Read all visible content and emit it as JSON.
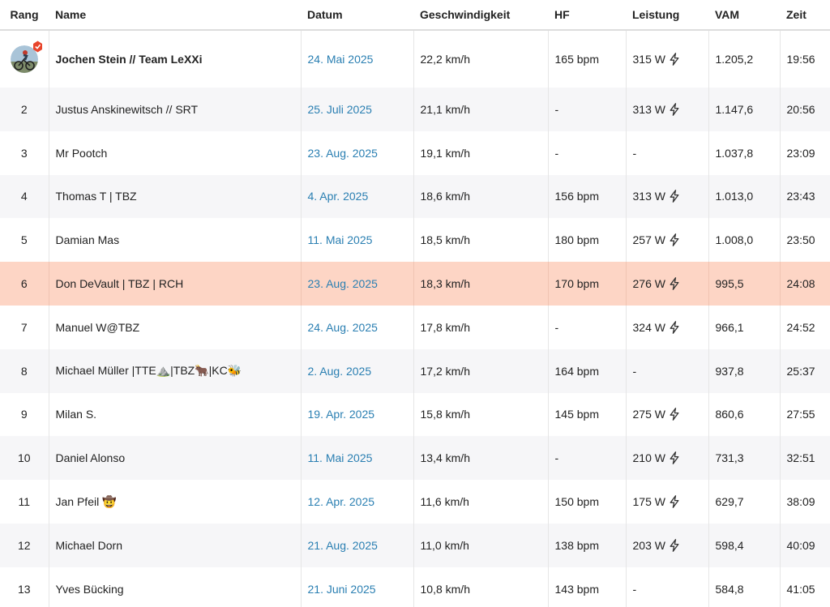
{
  "table": {
    "headers": [
      "Rang",
      "Name",
      "Datum",
      "Geschwindigkeit",
      "HF",
      "Leistung",
      "VAM",
      "Zeit"
    ],
    "rows": [
      {
        "rank": "",
        "name": "Jochen Stein // Team LeXXi",
        "date": "24. Mai 2025",
        "speed": "22,2 km/h",
        "hr": "165 bpm",
        "power": "315 W",
        "vam": "1.205,2",
        "time": "19:56"
      },
      {
        "rank": "2",
        "name": "Justus Anskinewitsch // SRT",
        "date": "25. Juli 2025",
        "speed": "21,1 km/h",
        "hr": "-",
        "power": "313 W",
        "vam": "1.147,6",
        "time": "20:56"
      },
      {
        "rank": "3",
        "name": "Mr Pootch",
        "date": "23. Aug. 2025",
        "speed": "19,1 km/h",
        "hr": "-",
        "power": "-",
        "vam": "1.037,8",
        "time": "23:09"
      },
      {
        "rank": "4",
        "name": "Thomas T | TBZ",
        "date": "4. Apr. 2025",
        "speed": "18,6 km/h",
        "hr": "156 bpm",
        "power": "313 W",
        "vam": "1.013,0",
        "time": "23:43"
      },
      {
        "rank": "5",
        "name": "Damian Mas",
        "date": "11. Mai 2025",
        "speed": "18,5 km/h",
        "hr": "180 bpm",
        "power": "257 W",
        "vam": "1.008,0",
        "time": "23:50"
      },
      {
        "rank": "6",
        "name": "Don DeVault | TBZ | RCH",
        "date": "23. Aug. 2025",
        "speed": "18,3 km/h",
        "hr": "170 bpm",
        "power": "276 W",
        "vam": "995,5",
        "time": "24:08"
      },
      {
        "rank": "7",
        "name": "Manuel W@TBZ",
        "date": "24. Aug. 2025",
        "speed": "17,8 km/h",
        "hr": "-",
        "power": "324 W",
        "vam": "966,1",
        "time": "24:52"
      },
      {
        "rank": "8",
        "name": "Michael Müller |TTE⛰️|TBZ🐂|KC🐝",
        "date": "2. Aug. 2025",
        "speed": "17,2 km/h",
        "hr": "164 bpm",
        "power": "-",
        "vam": "937,8",
        "time": "25:37"
      },
      {
        "rank": "9",
        "name": "Milan S.",
        "date": "19. Apr. 2025",
        "speed": "15,8 km/h",
        "hr": "145 bpm",
        "power": "275 W",
        "vam": "860,6",
        "time": "27:55"
      },
      {
        "rank": "10",
        "name": "Daniel Alonso",
        "date": "11. Mai 2025",
        "speed": "13,4 km/h",
        "hr": "-",
        "power": "210 W",
        "vam": "731,3",
        "time": "32:51"
      },
      {
        "rank": "11",
        "name": "Jan Pfeil 🤠",
        "date": "12. Apr. 2025",
        "speed": "11,6 km/h",
        "hr": "150 bpm",
        "power": "175 W",
        "vam": "629,7",
        "time": "38:09"
      },
      {
        "rank": "12",
        "name": "Michael Dorn",
        "date": "21. Aug. 2025",
        "speed": "11,0 km/h",
        "hr": "138 bpm",
        "power": "203 W",
        "vam": "598,4",
        "time": "40:09"
      },
      {
        "rank": "13",
        "name": "Yves Bücking",
        "date": "21. Juni 2025",
        "speed": "10,8 km/h",
        "hr": "143 bpm",
        "power": "-",
        "vam": "584,8",
        "time": "41:05"
      }
    ]
  },
  "icons": {
    "power": "lightning-bolt-icon",
    "leader_badge": "crown-badge-icon"
  },
  "colors": {
    "link": "#2a7fb2",
    "highlight_row": "#fdd5c5",
    "stripe_row": "#f6f6f8",
    "badge": "#e8452c"
  }
}
